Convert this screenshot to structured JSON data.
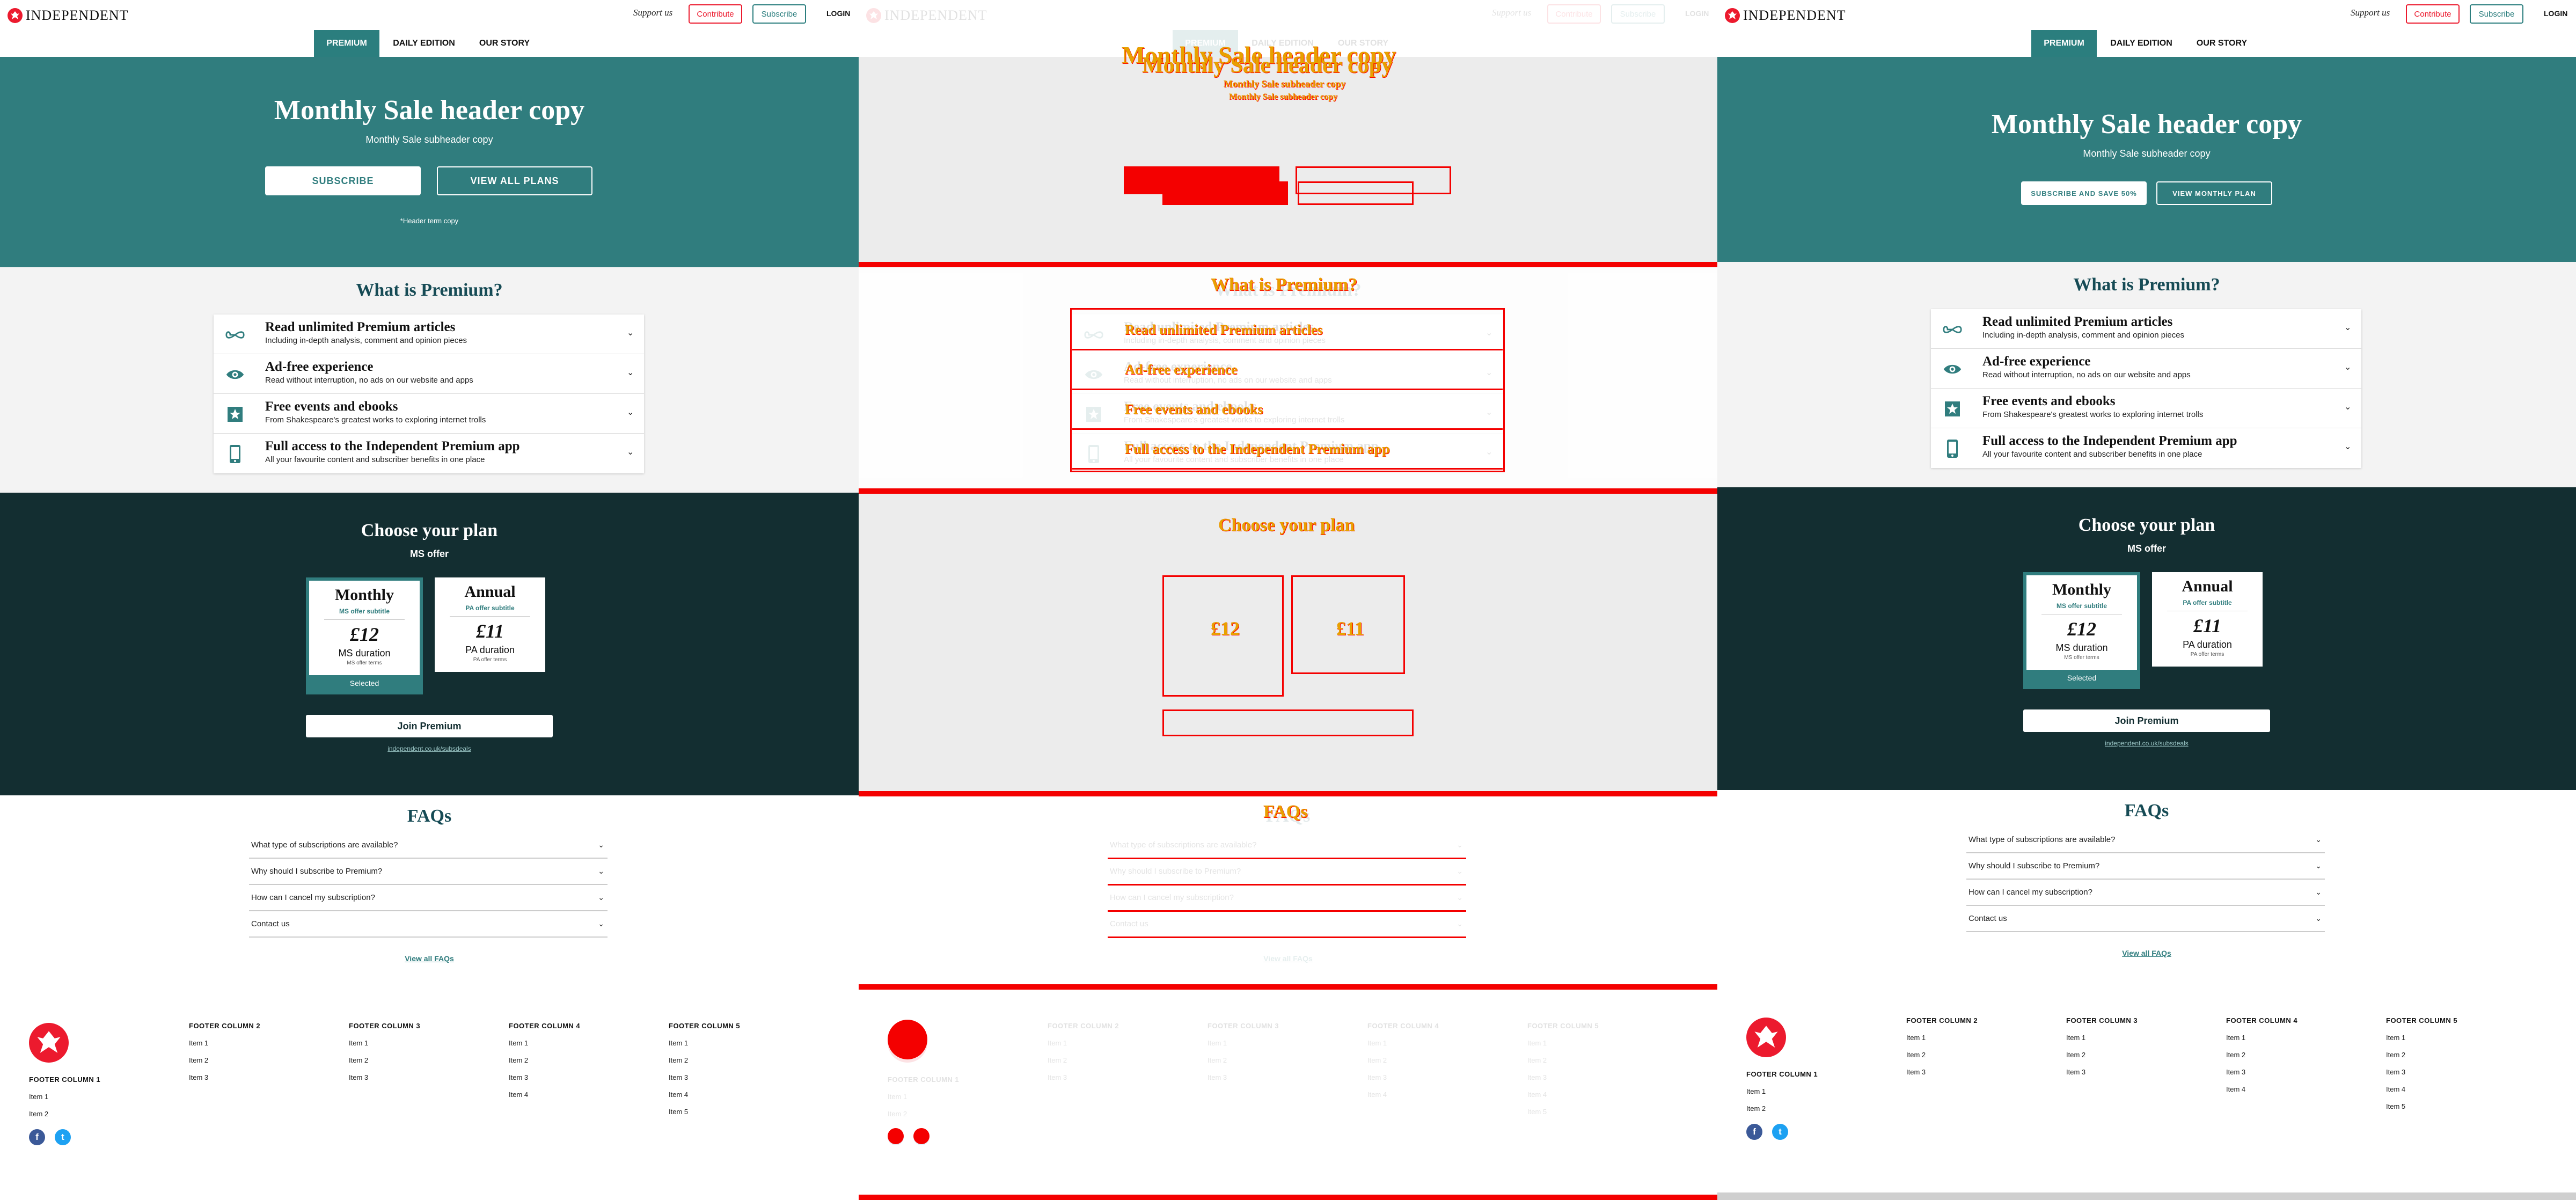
{
  "header": {
    "logo": "INDEPENDENT",
    "support": "Support us",
    "contribute": "Contribute",
    "subscribe": "Subscribe",
    "login": "LOGIN"
  },
  "nav": {
    "tabs": [
      "PREMIUM",
      "DAILY EDITION",
      "OUR STORY"
    ]
  },
  "hero": {
    "title": "Monthly Sale header copy",
    "subtitle": "Monthly Sale subheader copy",
    "subscribe": "SUBSCRIBE",
    "view_all": "VIEW ALL PLANS",
    "note": "*Header term copy",
    "variant_subscribe": "SUBSCRIBE AND SAVE 50%",
    "variant_view": "VIEW MONTHLY PLAN"
  },
  "premium": {
    "heading": "What is Premium?",
    "features": [
      {
        "title": "Read unlimited Premium articles",
        "sub": "Including in-depth analysis, comment and opinion pieces",
        "icon": "infinity-icon"
      },
      {
        "title": "Ad-free experience",
        "sub": "Read without interruption, no ads on our website and apps",
        "icon": "eye-icon"
      },
      {
        "title": "Free events and ebooks",
        "sub": "From Shakespeare's greatest works to exploring internet trolls",
        "icon": "star-ticket-icon"
      },
      {
        "title": "Full access to the Independent Premium app",
        "sub": "All your favourite content and subscriber benefits in one place",
        "icon": "phone-icon"
      }
    ]
  },
  "plan": {
    "heading": "Choose your plan",
    "offer": "MS offer",
    "monthly": {
      "name": "Monthly",
      "subtitle": "MS offer subtitle",
      "price": "£12",
      "duration": "MS duration",
      "terms": "MS offer terms",
      "selected": "Selected"
    },
    "annual": {
      "name": "Annual",
      "subtitle": "PA offer subtitle",
      "price": "£11",
      "duration": "PA duration",
      "terms": "PA offer terms"
    },
    "join": "Join Premium",
    "link": "independent.co.uk/subsdeals"
  },
  "faq": {
    "heading": "FAQs",
    "questions": [
      "What type of subscriptions are available?",
      "Why should I subscribe to Premium?",
      "How can I cancel my subscription?",
      "Contact us"
    ],
    "view_all": "View all FAQs"
  },
  "footer": {
    "col1": {
      "title": "FOOTER COLUMN 1",
      "items": [
        "Item 1",
        "Item 2"
      ]
    },
    "col2": {
      "title": "FOOTER COLUMN 2",
      "items": [
        "Item 1",
        "Item 2",
        "Item 3"
      ]
    },
    "col3": {
      "title": "FOOTER COLUMN 3",
      "items": [
        "Item 1",
        "Item 2",
        "Item 3"
      ]
    },
    "col4": {
      "title": "FOOTER COLUMN 4",
      "items": [
        "Item 1",
        "Item 2",
        "Item 3",
        "Item 4"
      ]
    },
    "col5": {
      "title": "FOOTER COLUMN 5",
      "items": [
        "Item 1",
        "Item 2",
        "Item 3",
        "Item 4",
        "Item 5"
      ]
    },
    "social": [
      {
        "icon": "facebook-icon",
        "glyph": "f",
        "color": "#3b5998"
      },
      {
        "icon": "twitter-icon",
        "glyph": "t",
        "color": "#1da1f2"
      }
    ]
  },
  "colors": {
    "teal": "#307d7e",
    "dark": "#132e31",
    "red": "#ec1a2e",
    "diff_red": "#f40000"
  }
}
